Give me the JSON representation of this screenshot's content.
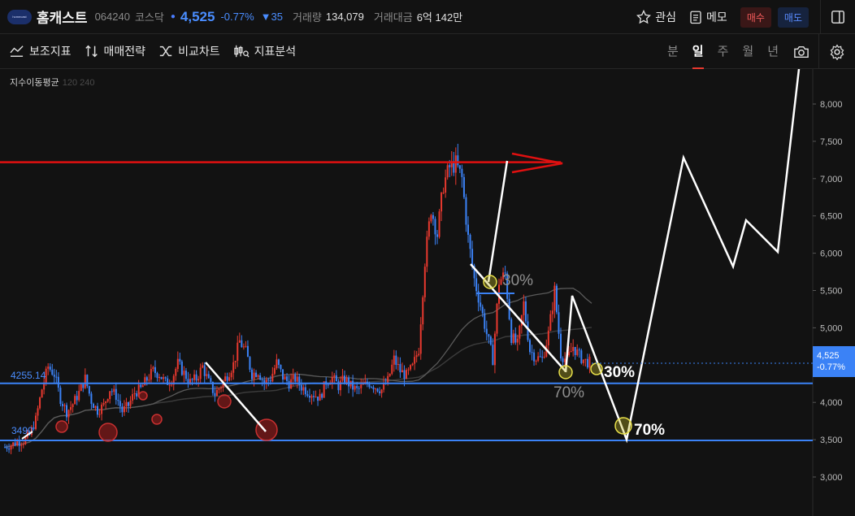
{
  "header": {
    "logo_text": "homecast",
    "stock_name": "홈캐스트",
    "code": "064240",
    "market": "코스닥",
    "price": "4,525",
    "change_pct": "-0.77%",
    "change_abs": "▼35",
    "volume_label": "거래량",
    "volume": "134,079",
    "value_label": "거래대금",
    "value": "6억 142만",
    "watch_label": "관심",
    "memo_label": "메모",
    "buy_label": "매수",
    "sell_label": "매도"
  },
  "toolbar": {
    "tools": [
      "보조지표",
      "매매전략",
      "비교차트",
      "지표분석"
    ],
    "periods": [
      "분",
      "일",
      "주",
      "월",
      "년"
    ],
    "active_period": "일"
  },
  "chart": {
    "indicator_label": "지수이동평균",
    "indicator_periods": "120 240",
    "current_price": "4,525",
    "current_change": "-0.77%",
    "level_1_label": "4255.14",
    "level_2_label": "3490",
    "annotations": [
      "30%",
      "70%",
      "30%",
      "70%"
    ],
    "colors": {
      "up": "#e8392f",
      "down": "#3b82f6",
      "level": "#3b82f6",
      "resistance": "#e01010"
    }
  },
  "chart_data": {
    "type": "candlestick",
    "y_ticks": [
      "8,000",
      "7,500",
      "7,000",
      "6,500",
      "6,000",
      "5,500",
      "5,000",
      "4,500",
      "4,000",
      "3,500",
      "3,000"
    ],
    "ylim": [
      2700,
      8500
    ],
    "horizontal_levels": [
      4255.14,
      3490
    ],
    "resistance_level": 7220,
    "current": 4525,
    "close_path": [
      3400,
      3430,
      3470,
      3480,
      3560,
      3770,
      4180,
      4480,
      4380,
      4050,
      3870,
      3980,
      4130,
      4320,
      4020,
      3890,
      3960,
      4180,
      4090,
      3880,
      3960,
      4130,
      4180,
      4310,
      4420,
      4380,
      4260,
      4310,
      4520,
      4390,
      4270,
      4320,
      4480,
      4270,
      4110,
      4230,
      4370,
      4510,
      4820,
      4680,
      4380,
      4420,
      4260,
      4320,
      4530,
      4340,
      4260,
      4320,
      4210,
      4150,
      4110,
      4060,
      4280,
      4330,
      4220,
      4320,
      4220,
      4160,
      4220,
      4260,
      4210,
      4170,
      4290,
      4580,
      4420,
      4360,
      4470,
      4720,
      5900,
      6600,
      6250,
      6920,
      7150,
      7200,
      7000,
      6200,
      5650,
      5300,
      4920,
      4580,
      5620,
      5720,
      4880,
      4770,
      5320,
      4700,
      4600,
      4580,
      4920,
      5500,
      4650,
      4560,
      4750,
      4620,
      4550,
      4525
    ],
    "projection": [
      [
        5450,
        4550
      ],
      [
        4900,
        4550
      ],
      [
        3500,
        5150
      ],
      [
        7280,
        7000
      ],
      [
        5850,
        5900
      ],
      [
        6460,
        6000
      ],
      [
        6020,
        6300
      ],
      [
        8500,
        7230
      ]
    ]
  }
}
